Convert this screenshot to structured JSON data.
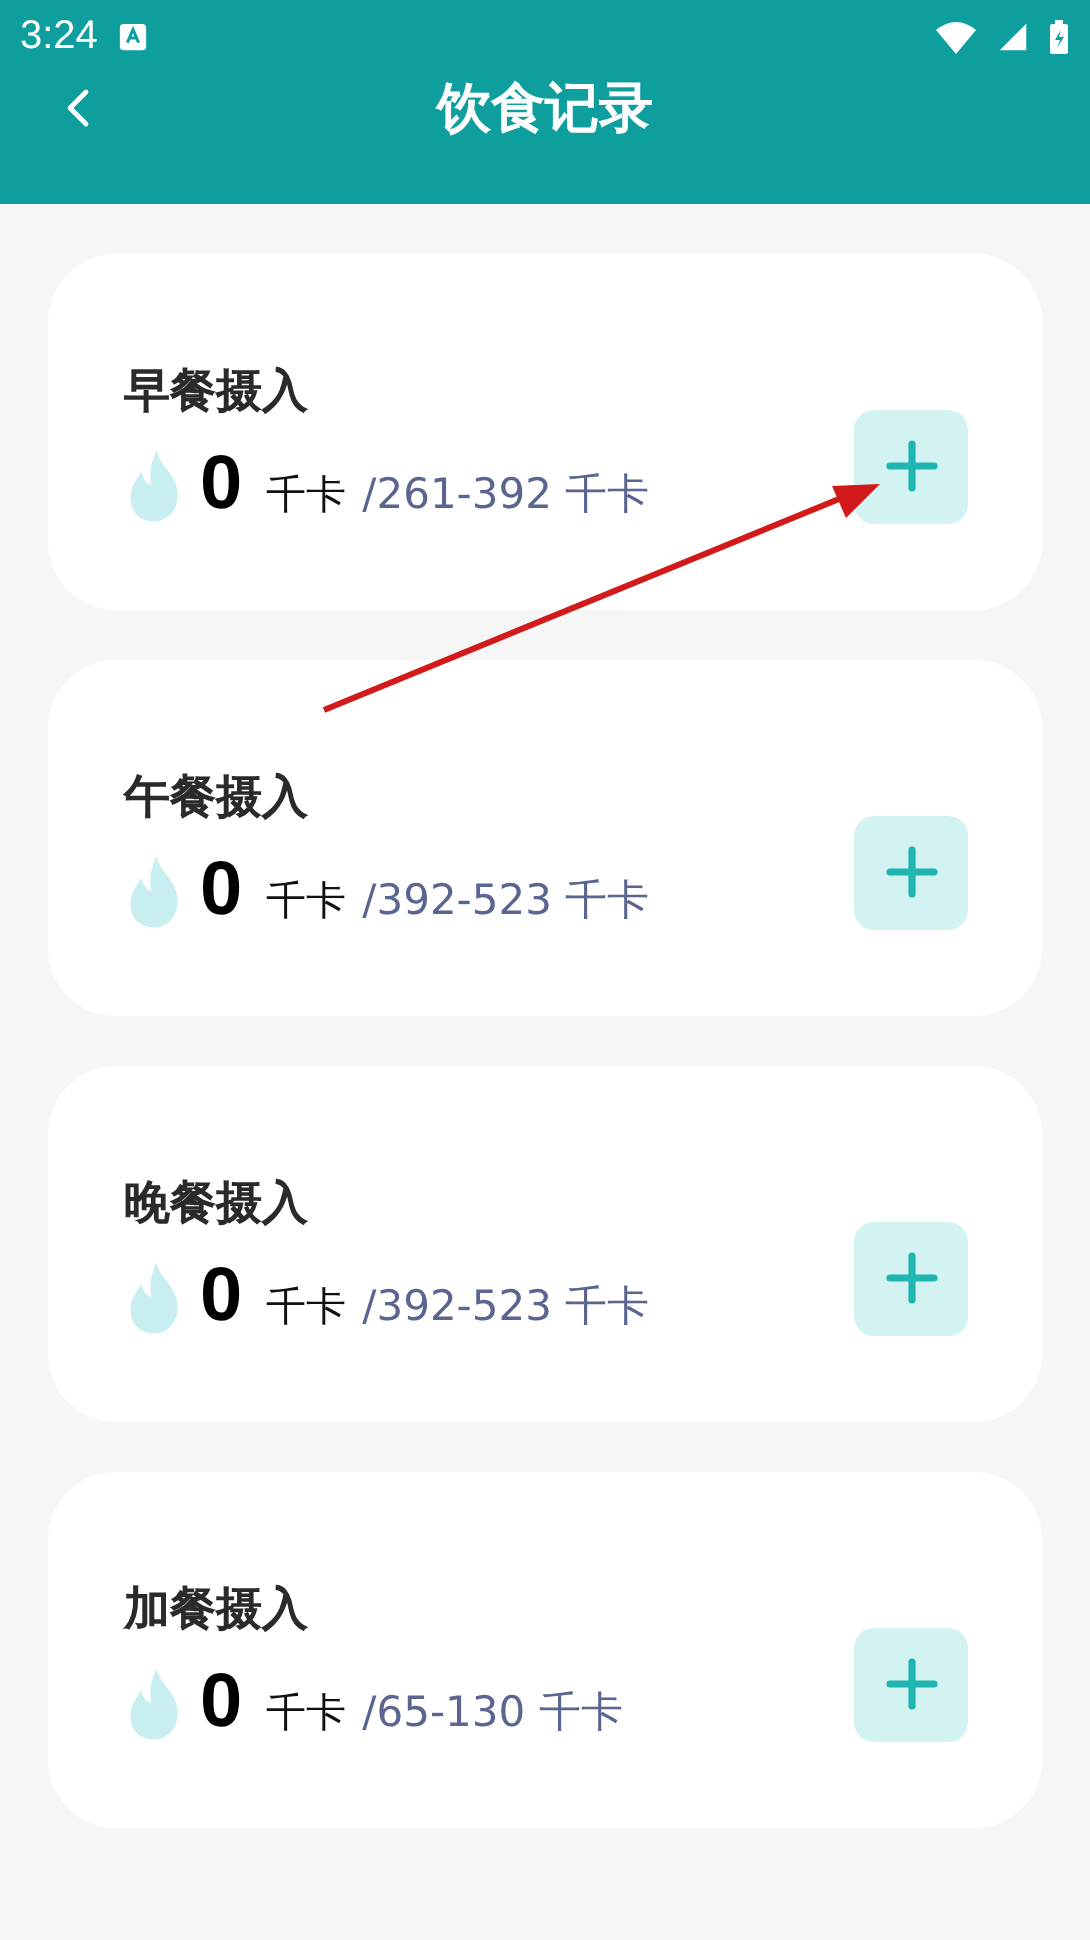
{
  "status_bar": {
    "time": "3:24"
  },
  "header": {
    "title": "饮食记录"
  },
  "meals": [
    {
      "title": "早餐摄入",
      "amount": "0",
      "unit": "千卡",
      "range": "/261-392 千卡"
    },
    {
      "title": "午餐摄入",
      "amount": "0",
      "unit": "千卡",
      "range": "/392-523 千卡"
    },
    {
      "title": "晚餐摄入",
      "amount": "0",
      "unit": "千卡",
      "range": "/392-523 千卡"
    },
    {
      "title": "加餐摄入",
      "amount": "0",
      "unit": "千卡",
      "range": "/65-130 千卡"
    }
  ],
  "annotation": {
    "kind": "arrow",
    "color": "#d21a1a"
  }
}
